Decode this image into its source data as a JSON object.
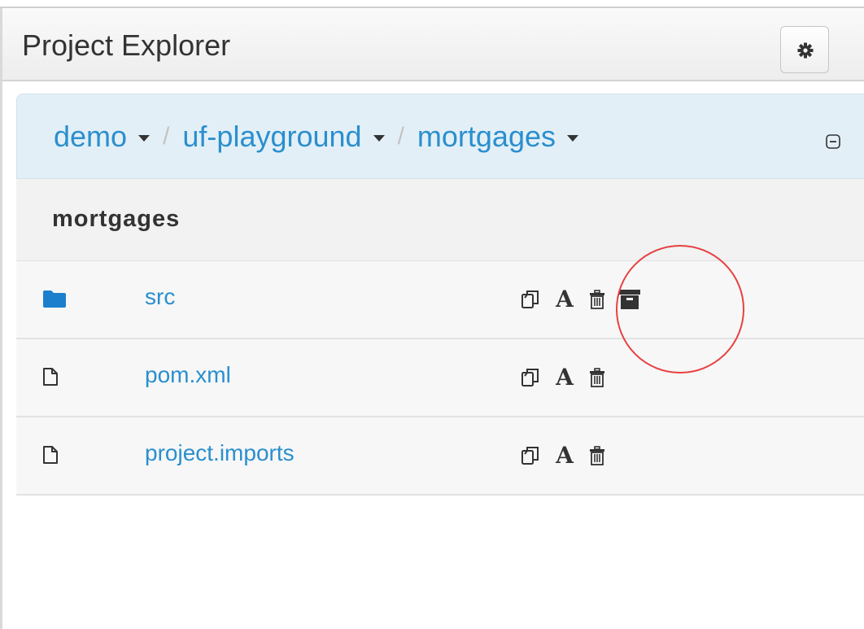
{
  "header": {
    "title": "Project Explorer",
    "settings_icon": "gear-icon"
  },
  "breadcrumb": {
    "items": [
      {
        "label": "demo"
      },
      {
        "label": "uf-playground"
      },
      {
        "label": "mortgages"
      }
    ],
    "separator": "/",
    "collapse_icon": "minus-square-icon"
  },
  "folder": {
    "title": "mortgages"
  },
  "files": [
    {
      "name": "src",
      "type": "folder",
      "icon": "folder-icon",
      "actions": [
        "copy-icon",
        "rename-icon",
        "trash-icon",
        "archive-icon"
      ]
    },
    {
      "name": "pom.xml",
      "type": "file",
      "icon": "file-icon",
      "actions": [
        "copy-icon",
        "rename-icon",
        "trash-icon"
      ]
    },
    {
      "name": "project.imports",
      "type": "file",
      "icon": "file-icon",
      "actions": [
        "copy-icon",
        "rename-icon",
        "trash-icon"
      ]
    }
  ],
  "rename_glyph": "A",
  "colors": {
    "link": "#2a8fce",
    "breadcrumb_bg": "#e3eff7",
    "highlight_circle": "#e64141",
    "folder_icon": "#1b7fce"
  }
}
